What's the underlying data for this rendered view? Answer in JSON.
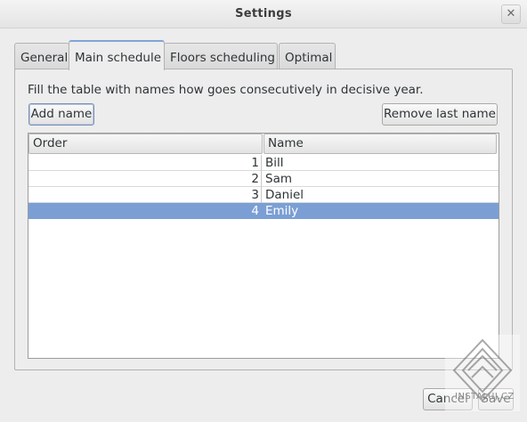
{
  "window": {
    "title": "Settings",
    "close_symbol": "✕"
  },
  "tabs": [
    {
      "label": "General",
      "active": false
    },
    {
      "label": "Main schedule",
      "active": true
    },
    {
      "label": "Floors scheduling",
      "active": false
    },
    {
      "label": "Optimal",
      "active": false
    }
  ],
  "main": {
    "instruction": "Fill the table with names how goes consecutively in decisive year.",
    "add_button": "Add name",
    "remove_button": "Remove last name",
    "table": {
      "headers": {
        "order": "Order",
        "name": "Name"
      },
      "rows": [
        {
          "order": "1",
          "name": "Bill",
          "selected": false
        },
        {
          "order": "2",
          "name": "Sam",
          "selected": false
        },
        {
          "order": "3",
          "name": "Daniel",
          "selected": false
        },
        {
          "order": "4",
          "name": "Emily",
          "selected": true
        }
      ]
    }
  },
  "footer": {
    "cancel_button": "Cancel",
    "save_button": "Save"
  },
  "watermark": {
    "text": "INSTALUJ.CZ"
  },
  "colors": {
    "selection": "#7b9fd4",
    "active_tab_accent": "#7fa6d6"
  }
}
